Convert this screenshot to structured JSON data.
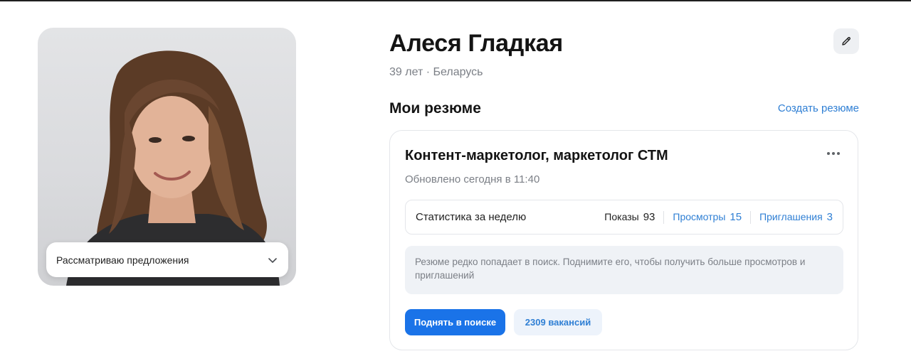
{
  "profile": {
    "name": "Алеся Гладкая",
    "meta": "39 лет · Беларусь",
    "status_select": "Рассматриваю предложения"
  },
  "resumes": {
    "title": "Мои резюме",
    "create_link": "Создать резюме",
    "items": [
      {
        "title": "Контент-маркетолог, маркетолог СТМ",
        "updated": "Обновлено сегодня в 11:40",
        "stats": {
          "label": "Статистика за неделю",
          "impressions_label": "Показы",
          "impressions": "93",
          "views_label": "Просмотры",
          "views": "15",
          "invites_label": "Приглашения",
          "invites": "3"
        },
        "tip": "Резюме редко попадает в поиск. Поднимите его, чтобы получить больше просмотров и приглашений",
        "raise_button": "Поднять в поиске",
        "vacancies_button": "2309 вакансий"
      }
    ]
  },
  "colors": {
    "accent": "#1a73e8",
    "link": "#2f7fd4",
    "muted_text": "#7b7f86",
    "tip_bg": "#eff2f6"
  },
  "icons": {
    "edit": "pencil-icon",
    "more": "more-dots-icon",
    "select": "chevron-down-icon"
  }
}
